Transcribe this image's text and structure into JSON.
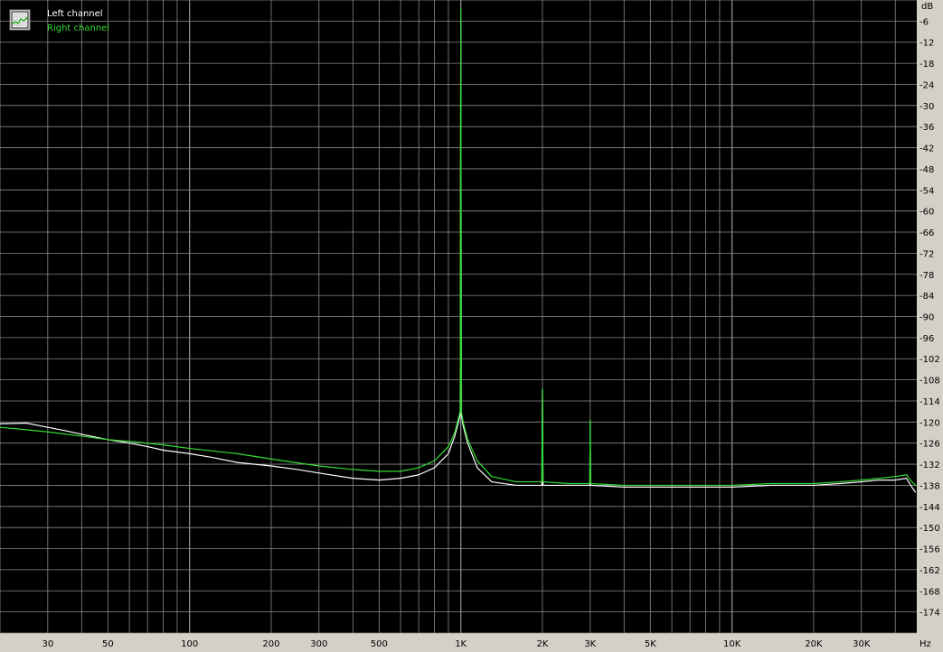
{
  "chart_data": {
    "type": "line",
    "xscale": "log",
    "xlim": [
      20,
      48000
    ],
    "ylim": [
      -180,
      0
    ],
    "xunit": "Hz",
    "yunit": "dB",
    "grid": true,
    "legend_position": "top-left",
    "background": "#000000",
    "colors": {
      "grid": "#8a8a8a",
      "left": "#ffffff",
      "right": "#33dd33",
      "frame": "#d4d0c8"
    },
    "legend": [
      {
        "name": "Left channel",
        "color": "#ffffff"
      },
      {
        "name": "Right channel",
        "color": "#33dd33"
      }
    ],
    "xticks": [
      {
        "value": 30,
        "label": "30"
      },
      {
        "value": 50,
        "label": "50"
      },
      {
        "value": 100,
        "label": "100"
      },
      {
        "value": 200,
        "label": "200"
      },
      {
        "value": 300,
        "label": "300"
      },
      {
        "value": 500,
        "label": "500"
      },
      {
        "value": 1000,
        "label": "1K"
      },
      {
        "value": 2000,
        "label": "2K"
      },
      {
        "value": 3000,
        "label": "3K"
      },
      {
        "value": 5000,
        "label": "5K"
      },
      {
        "value": 10000,
        "label": "10K"
      },
      {
        "value": 20000,
        "label": "20K"
      },
      {
        "value": 30000,
        "label": "30K"
      }
    ],
    "yticks": [
      -6,
      -12,
      -18,
      -24,
      -30,
      -36,
      -42,
      -48,
      -54,
      -60,
      -66,
      -72,
      -78,
      -84,
      -90,
      -96,
      -102,
      -108,
      -114,
      -120,
      -126,
      -132,
      -138,
      -144,
      -150,
      -156,
      -162,
      -168,
      -174
    ],
    "series": [
      {
        "name": "Left channel",
        "color": "#ffffff",
        "points": [
          [
            20,
            -120.5
          ],
          [
            25,
            -120.3
          ],
          [
            30,
            -121.5
          ],
          [
            35,
            -122.5
          ],
          [
            40,
            -123.5
          ],
          [
            50,
            -125
          ],
          [
            60,
            -126
          ],
          [
            70,
            -127
          ],
          [
            80,
            -128
          ],
          [
            100,
            -129
          ],
          [
            120,
            -130
          ],
          [
            150,
            -131.5
          ],
          [
            200,
            -132.5
          ],
          [
            250,
            -133.5
          ],
          [
            300,
            -134.5
          ],
          [
            400,
            -136
          ],
          [
            500,
            -136.5
          ],
          [
            600,
            -136
          ],
          [
            700,
            -135
          ],
          [
            800,
            -133
          ],
          [
            900,
            -129
          ],
          [
            950,
            -124
          ],
          [
            980,
            -120
          ],
          [
            995,
            -118
          ],
          [
            1000,
            -6
          ],
          [
            1005,
            -118
          ],
          [
            1020,
            -121
          ],
          [
            1060,
            -126
          ],
          [
            1150,
            -133
          ],
          [
            1300,
            -137
          ],
          [
            1600,
            -138
          ],
          [
            1990,
            -138
          ],
          [
            2000,
            -111
          ],
          [
            2010,
            -138
          ],
          [
            2500,
            -138
          ],
          [
            2990,
            -138
          ],
          [
            3000,
            -120
          ],
          [
            3010,
            -138
          ],
          [
            4000,
            -138.5
          ],
          [
            5000,
            -138.5
          ],
          [
            7000,
            -138.5
          ],
          [
            10000,
            -138.5
          ],
          [
            14000,
            -138
          ],
          [
            20000,
            -138
          ],
          [
            25000,
            -137.5
          ],
          [
            30000,
            -137
          ],
          [
            35000,
            -136.5
          ],
          [
            40000,
            -136.5
          ],
          [
            44000,
            -136
          ],
          [
            46000,
            -138.5
          ],
          [
            47500,
            -140
          ]
        ]
      },
      {
        "name": "Right channel",
        "color": "#33dd33",
        "points": [
          [
            20,
            -121.5
          ],
          [
            25,
            -122.2
          ],
          [
            30,
            -122.8
          ],
          [
            40,
            -124
          ],
          [
            50,
            -125
          ],
          [
            60,
            -125.5
          ],
          [
            80,
            -126.5
          ],
          [
            100,
            -127.5
          ],
          [
            150,
            -129
          ],
          [
            200,
            -130.5
          ],
          [
            300,
            -132.5
          ],
          [
            400,
            -133.5
          ],
          [
            500,
            -134
          ],
          [
            600,
            -134
          ],
          [
            700,
            -133
          ],
          [
            800,
            -131
          ],
          [
            900,
            -127
          ],
          [
            950,
            -123
          ],
          [
            980,
            -119
          ],
          [
            995,
            -117
          ],
          [
            1000,
            -2.5
          ],
          [
            1005,
            -117
          ],
          [
            1020,
            -120
          ],
          [
            1060,
            -125
          ],
          [
            1150,
            -131
          ],
          [
            1300,
            -135.5
          ],
          [
            1600,
            -137
          ],
          [
            1990,
            -137
          ],
          [
            2000,
            -110.5
          ],
          [
            2010,
            -137
          ],
          [
            2500,
            -137.5
          ],
          [
            2990,
            -137.5
          ],
          [
            3000,
            -119.5
          ],
          [
            3010,
            -137.5
          ],
          [
            4000,
            -138
          ],
          [
            5000,
            -138
          ],
          [
            7000,
            -138
          ],
          [
            10000,
            -138
          ],
          [
            14000,
            -137.5
          ],
          [
            20000,
            -137.5
          ],
          [
            25000,
            -137
          ],
          [
            30000,
            -136.5
          ],
          [
            35000,
            -136
          ],
          [
            40000,
            -135.5
          ],
          [
            44000,
            -135
          ],
          [
            46000,
            -137
          ],
          [
            47500,
            -138
          ]
        ]
      }
    ]
  }
}
